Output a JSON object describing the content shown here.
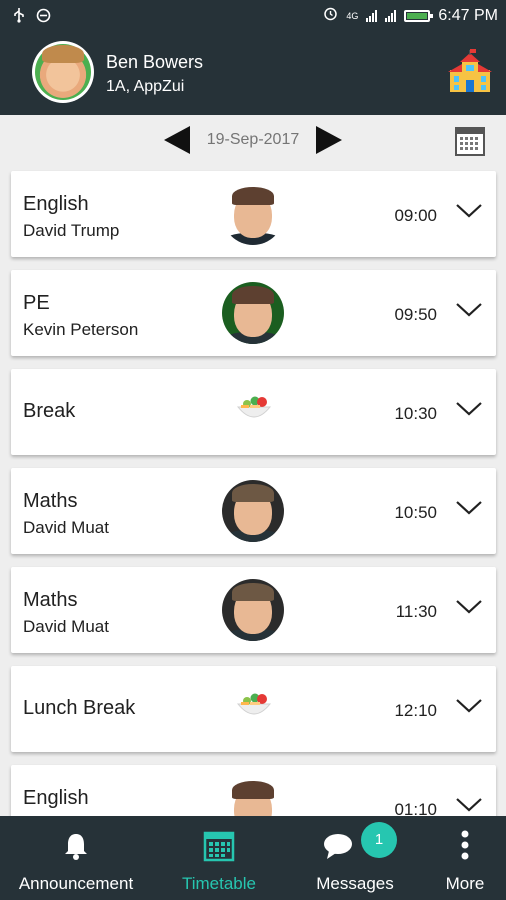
{
  "status_bar": {
    "time": "6:47 PM",
    "network": "4G"
  },
  "header": {
    "user_name": "Ben Bowers",
    "user_class": "1A, AppZui"
  },
  "date_nav": {
    "date": "19-Sep-2017"
  },
  "periods": [
    {
      "subject": "English",
      "teacher": "David Trump",
      "time": "09:00",
      "icon": "teacher-photo"
    },
    {
      "subject": "PE",
      "teacher": "Kevin Peterson",
      "time": "09:50",
      "icon": "teacher-photo"
    },
    {
      "subject": "Break",
      "teacher": "",
      "time": "10:30",
      "icon": "food-bowl-icon"
    },
    {
      "subject": "Maths",
      "teacher": "David Muat",
      "time": "10:50",
      "icon": "teacher-photo"
    },
    {
      "subject": "Maths",
      "teacher": "David Muat",
      "time": "11:30",
      "icon": "teacher-photo"
    },
    {
      "subject": "Lunch Break",
      "teacher": "",
      "time": "12:10",
      "icon": "food-bowl-icon"
    },
    {
      "subject": "English",
      "teacher": "",
      "time": "01:10",
      "icon": "teacher-photo"
    }
  ],
  "bottom_nav": {
    "items": [
      {
        "label": "Announcement",
        "icon": "bell-icon"
      },
      {
        "label": "Timetable",
        "icon": "calendar-grid-icon",
        "active": true
      },
      {
        "label": "Messages",
        "icon": "chat-bubble-icon",
        "badge": "1"
      },
      {
        "label": "More",
        "icon": "more-vertical-icon"
      }
    ]
  },
  "colors": {
    "bar_background": "#263238",
    "accent": "#26c6b0",
    "page_background": "#eeeeee"
  }
}
